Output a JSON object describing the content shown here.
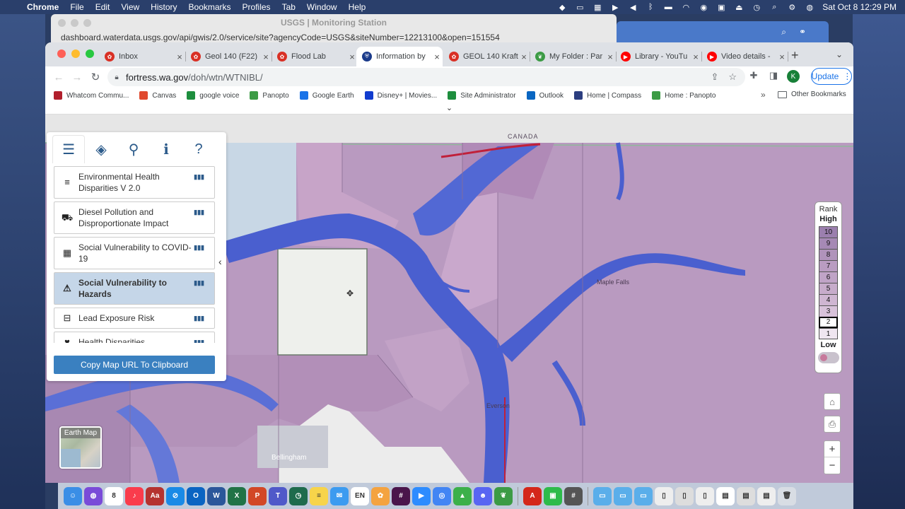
{
  "menubar": {
    "app": "Chrome",
    "items": [
      "File",
      "Edit",
      "View",
      "History",
      "Bookmarks",
      "Profiles",
      "Tab",
      "Window",
      "Help"
    ],
    "datetime": "Sat Oct 8  12:29 PM"
  },
  "background_window": {
    "title": "USGS | Monitoring Station",
    "url": "dashboard.waterdata.usgs.gov/api/gwis/2.0/service/site?agencyCode=USGS&siteNumber=12213100&open=151554"
  },
  "tabs": [
    {
      "label": "Inbox",
      "color": "#d93025",
      "glyph": "✿"
    },
    {
      "label": "Geol 140 (F22)",
      "color": "#d93025",
      "glyph": "✿"
    },
    {
      "label": "Flood Lab",
      "color": "#d93025",
      "glyph": "✿"
    },
    {
      "label": "Information by",
      "color": "#1a3a8a",
      "glyph": "⛨",
      "active": true
    },
    {
      "label": "GEOL 140 Kraft",
      "color": "#d93025",
      "glyph": "✿"
    },
    {
      "label": "My Folder : Par",
      "color": "#3c9b45",
      "glyph": "❦"
    },
    {
      "label": "Library - YouTu",
      "color": "#ff0000",
      "glyph": "▶"
    },
    {
      "label": "Video details -",
      "color": "#ff0000",
      "glyph": "▶"
    }
  ],
  "address": {
    "host": "fortress.wa.gov",
    "path": "/doh/wtn/WTNIBL/"
  },
  "toolbar": {
    "avatar_letter": "K",
    "update_label": "Update"
  },
  "bookmarks": [
    {
      "label": "Whatcom Commu...",
      "color": "#b11f2c"
    },
    {
      "label": "Canvas",
      "color": "#e0492e"
    },
    {
      "label": "google voice",
      "color": "#1e8e3e"
    },
    {
      "label": "Panopto",
      "color": "#3c9b45"
    },
    {
      "label": "Google Earth",
      "color": "#1a73e8"
    },
    {
      "label": "Disney+ | Movies...",
      "color": "#113ccf"
    },
    {
      "label": "Site Administrator",
      "color": "#1e8e3e"
    },
    {
      "label": "Outlook",
      "color": "#0a66c2"
    },
    {
      "label": "Home | Compass",
      "color": "#2c3e80"
    },
    {
      "label": "Home : Panopto",
      "color": "#3c9b45"
    }
  ],
  "bookmarks_other": "Other Bookmarks",
  "map": {
    "country_label": "CANADA",
    "places": [
      "Maple Falls",
      "Everson",
      "Bellingham"
    ],
    "earth_map_label": "Earth Map"
  },
  "panel": {
    "tab_icons": [
      "list-icon",
      "layers-icon",
      "map-pin-icon",
      "info-icon",
      "help-icon"
    ],
    "layers": [
      {
        "label": "Environmental Health Disparities V 2.0",
        "icon": "equalizer-icon"
      },
      {
        "label": "Diesel Pollution and Disproportionate Impact",
        "icon": "truck-icon"
      },
      {
        "label": "Social Vulnerability to COVID-19",
        "icon": "grid-icon"
      },
      {
        "label": "Social Vulnerability to Hazards",
        "icon": "warning-icon",
        "active": true
      },
      {
        "label": "Lead Exposure Risk",
        "icon": "minus-box-icon"
      },
      {
        "label": "Health Disparities",
        "icon": "heart-icon"
      }
    ],
    "copy_button": "Copy Map URL To Clipboard"
  },
  "legend": {
    "title": "Rank",
    "high": "High",
    "low": "Low",
    "ranks": [
      "10",
      "9",
      "8",
      "7",
      "6",
      "5",
      "4",
      "3",
      "2",
      "1"
    ],
    "selected_rank": "2",
    "colors": [
      "#9b7fae",
      "#a689b5",
      "#b093bb",
      "#b99cc1",
      "#c0a4c7",
      "#c7accb",
      "#cfb6d2",
      "#d8c2da",
      "#e2d2e4",
      "#efe6f0"
    ]
  },
  "colors": {
    "map_fill": "#b99ac0",
    "river": "#4a5fcf",
    "accent": "#3a80c0"
  }
}
